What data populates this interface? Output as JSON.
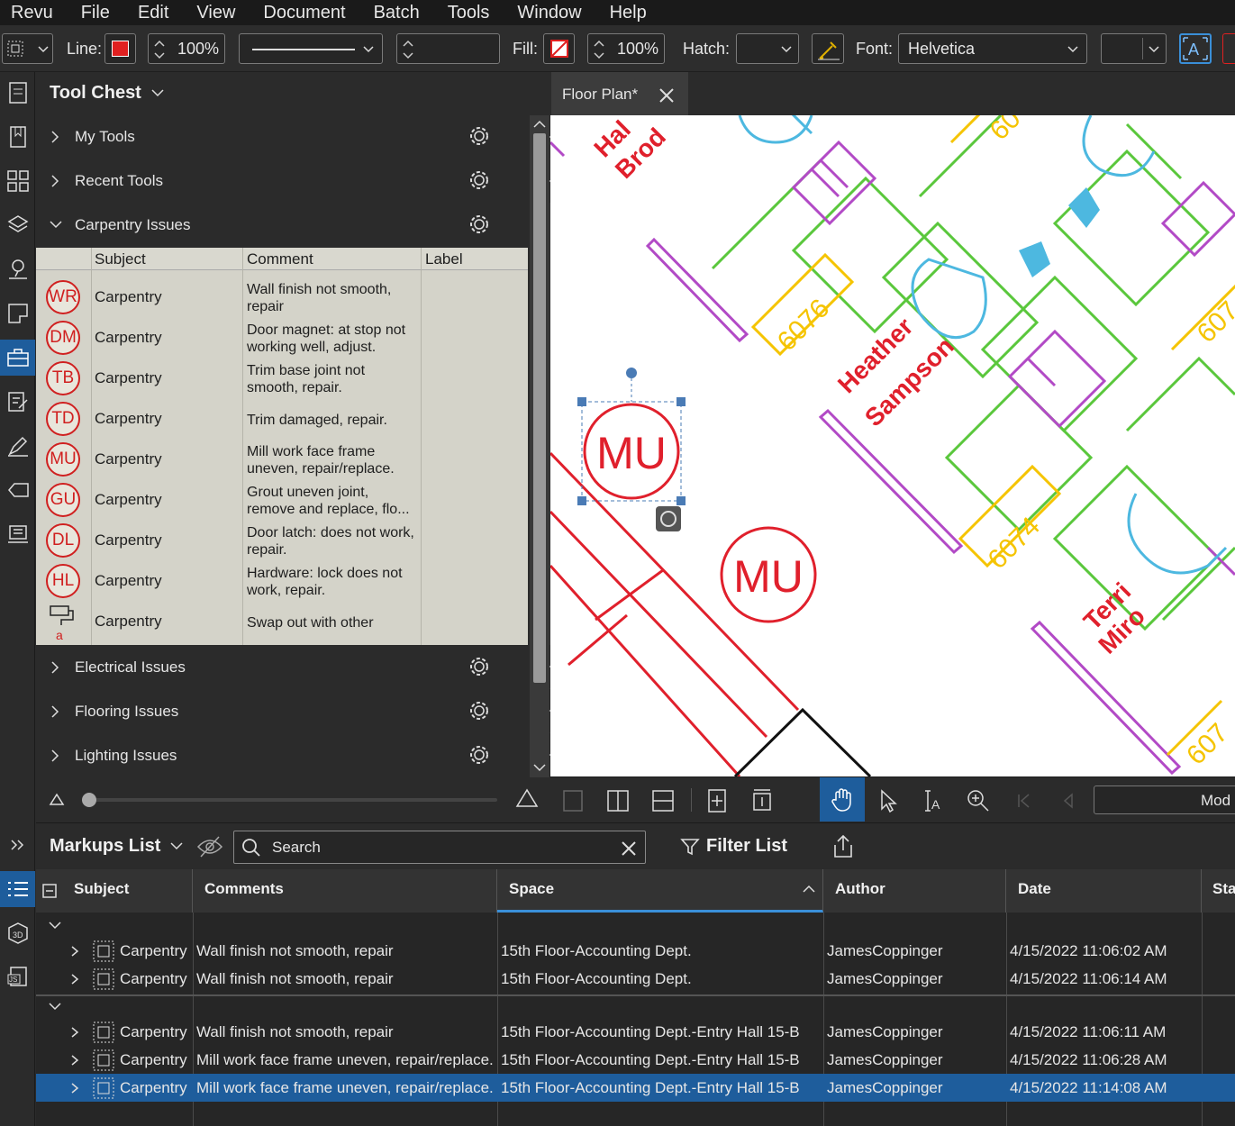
{
  "menu": [
    "Revu",
    "File",
    "Edit",
    "View",
    "Document",
    "Batch",
    "Tools",
    "Window",
    "Help"
  ],
  "toolbar": {
    "line_label": "Line:",
    "line_opacity": "100%",
    "fill_label": "Fill:",
    "fill_opacity": "100%",
    "hatch_label": "Hatch:",
    "font_label": "Font:",
    "font_value": "Helvetica",
    "line_color": "#e02020"
  },
  "tool_chest": {
    "title": "Tool Chest",
    "groups_top": [
      {
        "label": "My Tools"
      },
      {
        "label": "Recent Tools"
      },
      {
        "label": "Carpentry Issues"
      }
    ],
    "columns": [
      "Subject",
      "Comment",
      "Label"
    ],
    "tools": [
      {
        "badge": "WR",
        "subject": "Carpentry",
        "comment": "Wall finish not smooth, repair"
      },
      {
        "badge": "DM",
        "subject": "Carpentry",
        "comment": "Door magnet: at stop not working well, adjust."
      },
      {
        "badge": "TB",
        "subject": "Carpentry",
        "comment": "Trim base joint not smooth, repair."
      },
      {
        "badge": "TD",
        "subject": "Carpentry",
        "comment": "Trim damaged, repair."
      },
      {
        "badge": "MU",
        "subject": "Carpentry",
        "comment": "Mill work face frame uneven, repair/replace."
      },
      {
        "badge": "GU",
        "subject": "Carpentry",
        "comment": "Grout uneven joint, remove and replace, flo..."
      },
      {
        "badge": "DL",
        "subject": "Carpentry",
        "comment": "Door latch: does not work, repair."
      },
      {
        "badge": "HL",
        "subject": "Carpentry",
        "comment": "Hardware: lock does not work, repair."
      },
      {
        "badge": "",
        "subject": "Carpentry",
        "comment": "Swap out with other",
        "icon_letter": "a"
      }
    ],
    "groups_bottom": [
      {
        "label": "Electrical Issues"
      },
      {
        "label": "Flooring Issues"
      },
      {
        "label": "Lighting Issues"
      }
    ]
  },
  "document": {
    "tab_label": "Floor Plan*",
    "labels": {
      "room_6076": "6076",
      "room_6074": "6074",
      "room_607a": "607",
      "room_60a": "60",
      "room_607b": "607",
      "name1_line1": "Heather",
      "name1_line2": "Sampson",
      "name2_line1": "Terri",
      "name2_line2": "Miro",
      "name3_line1": "Hal",
      "name3_line2": "Brod",
      "markup1": "MU",
      "markup2": "MU"
    },
    "mode_label": "Mod"
  },
  "markups_list": {
    "title": "Markups List",
    "search_placeholder": "Search",
    "filter_label": "Filter List",
    "columns": [
      "Subject",
      "Comments",
      "Space",
      "Author",
      "Date",
      "Sta"
    ],
    "rows": [
      {
        "subject": "Carpentry",
        "comment": "Wall finish not smooth, repair",
        "space": "15th Floor-Accounting Dept.",
        "author": "JamesCoppinger",
        "date": "4/15/2022 11:06:02 AM"
      },
      {
        "subject": "Carpentry",
        "comment": "Wall finish not smooth, repair",
        "space": "15th Floor-Accounting Dept.",
        "author": "JamesCoppinger",
        "date": "4/15/2022 11:06:14 AM"
      },
      {
        "subject": "Carpentry",
        "comment": "Wall finish not smooth, repair",
        "space": "15th Floor-Accounting Dept.-Entry Hall 15-B",
        "author": "JamesCoppinger",
        "date": "4/15/2022 11:06:11 AM"
      },
      {
        "subject": "Carpentry",
        "comment": "Mill work face frame uneven, repair/replace.",
        "space": "15th Floor-Accounting Dept.-Entry Hall 15-B",
        "author": "JamesCoppinger",
        "date": "4/15/2022 11:06:28 AM"
      },
      {
        "subject": "Carpentry",
        "comment": "Mill work face frame uneven, repair/replace.",
        "space": "15th Floor-Accounting Dept.-Entry Hall 15-B",
        "author": "JamesCoppinger",
        "date": "4/15/2022 11:14:08 AM"
      }
    ]
  },
  "colors": {
    "accent": "#1e5d9c",
    "markup_red": "#d02020",
    "table_bg": "#d4d3c9"
  }
}
